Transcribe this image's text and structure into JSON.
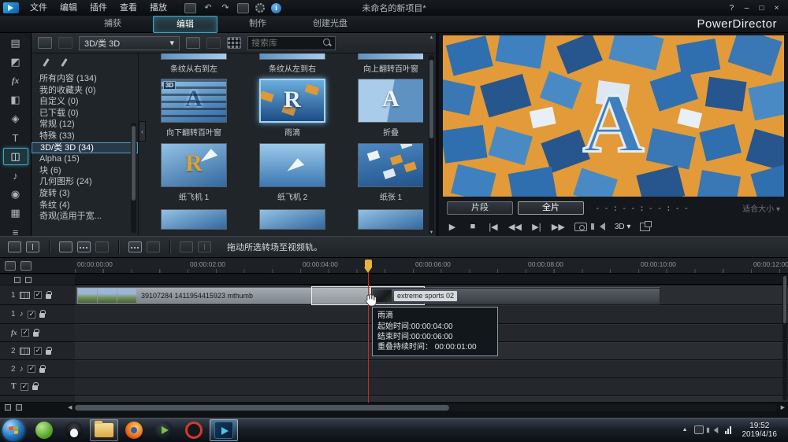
{
  "titlebar": {
    "menus": [
      "文件",
      "编辑",
      "插件",
      "查看",
      "播放"
    ],
    "title": "未命名的新项目*",
    "controls": {
      "help": "?",
      "minimize": "–",
      "maximize": "□",
      "close": "×"
    }
  },
  "tabs": {
    "capture": "捕获",
    "edit": "编辑",
    "produce": "制作",
    "create_disc": "创建光盘",
    "brand": "PowerDirector"
  },
  "library": {
    "dropdown_value": "3D/类 3D",
    "dropdown_arrow": "▾",
    "search_placeholder": "搜索库",
    "badge_3d": "3D",
    "categories": [
      {
        "label": "所有内容 (134)"
      },
      {
        "label": "我的收藏夹 (0)"
      },
      {
        "label": "自定义 (0)"
      },
      {
        "label": "已下载 (0)"
      },
      {
        "label": "常规 (12)"
      },
      {
        "label": "特殊 (33)"
      },
      {
        "label": "3D/类 3D (34)"
      },
      {
        "label": "Alpha (15)"
      },
      {
        "label": "块 (6)"
      },
      {
        "label": "几何图形 (24)"
      },
      {
        "label": "旋转 (3)"
      },
      {
        "label": "条纹 (4)"
      },
      {
        "label": "奇观(适用于宽..."
      }
    ],
    "top_row_labels": [
      "条纹从右到左",
      "条纹从左到右",
      "向上翻转百叶窗"
    ],
    "items": [
      {
        "label": "向下翻转百叶窗",
        "letter": "A"
      },
      {
        "label": "雨滴",
        "letter": "R"
      },
      {
        "label": "折叠",
        "letter": "A"
      },
      {
        "label": "纸飞机 1",
        "letter": "R"
      },
      {
        "label": "纸飞机 2",
        "letter": ""
      },
      {
        "label": "纸张 1",
        "letter": ""
      }
    ],
    "collapse_arrow": "‹"
  },
  "rail_icons": [
    {
      "name": "media-room",
      "glyph": "▤"
    },
    {
      "name": "adjust-room",
      "glyph": "◩"
    },
    {
      "name": "effect-room",
      "glyph": "fx"
    },
    {
      "name": "overlay-room",
      "glyph": "◧"
    },
    {
      "name": "particle-room",
      "glyph": "◈"
    },
    {
      "name": "title-room",
      "glyph": "T"
    },
    {
      "name": "transition-room",
      "glyph": "◫"
    },
    {
      "name": "audio-room",
      "glyph": "♪"
    },
    {
      "name": "voice-room",
      "glyph": "◉"
    },
    {
      "name": "chapter-room",
      "glyph": "▦"
    },
    {
      "name": "subtitle-room",
      "glyph": "≡"
    }
  ],
  "preview": {
    "letter": "A",
    "clip_button": "片段",
    "movie_button": "全片",
    "timecode": "- - : - - : - - : - -",
    "fit_label": "适合大小 ▾",
    "mode_3d_label": "3D ▾",
    "icons": {
      "play": "▶",
      "stop": "■",
      "prev": "|◀",
      "rew": "◀◀",
      "next": "▶|",
      "ffwd": "▶▶"
    }
  },
  "midbar": {
    "hint": "拖动所选转场至视频轨。"
  },
  "timeline": {
    "ruler_labels": [
      "00:00:00:00",
      "00:00:02:00",
      "00:00:04:00",
      "00:00:06:00",
      "00:00:08:00",
      "00:00:10:00",
      "00:00:12:00"
    ],
    "tracks": [
      {
        "num": "1"
      },
      {
        "num": "1"
      },
      {
        "num": "fx"
      },
      {
        "num": "2"
      },
      {
        "num": "2"
      },
      {
        "num": "T"
      }
    ],
    "clip1_label": "39107284 1411954415923 mthumb",
    "clip2_label": "extreme sports 02",
    "tooltip": {
      "title": "雨滴",
      "start": "起始时间:00:00:04:00",
      "end": "结束时间:00:00:06:00",
      "overlap": "重叠持续时间： 00:00:01:00"
    }
  },
  "taskbar": {
    "time": "19:52",
    "date": "2019/4/16"
  }
}
